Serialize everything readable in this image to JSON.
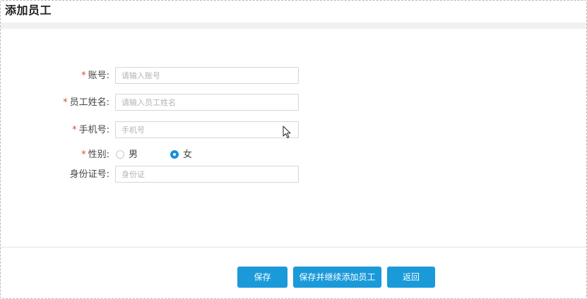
{
  "page": {
    "title": "添加员工"
  },
  "form": {
    "account": {
      "label": "账号:",
      "required_mark": "*",
      "placeholder": "请输入账号",
      "value": ""
    },
    "employee_name": {
      "label": "员工姓名:",
      "required_mark": "*",
      "placeholder": "请输入员工姓名",
      "value": ""
    },
    "phone": {
      "label": "手机号:",
      "required_mark": "*",
      "placeholder": "手机号",
      "value": ""
    },
    "gender": {
      "label": "性别:",
      "required_mark": "*",
      "options": [
        {
          "label": "男",
          "checked": false
        },
        {
          "label": "女",
          "checked": true
        }
      ]
    },
    "id_card": {
      "label": "身份证号:",
      "placeholder": "身份证",
      "value": ""
    }
  },
  "buttons": {
    "save": "保存",
    "save_and_continue": "保存并继续添加员工",
    "back": "返回"
  },
  "colors": {
    "accent": "#1a9ad9",
    "required": "#e0453a"
  }
}
